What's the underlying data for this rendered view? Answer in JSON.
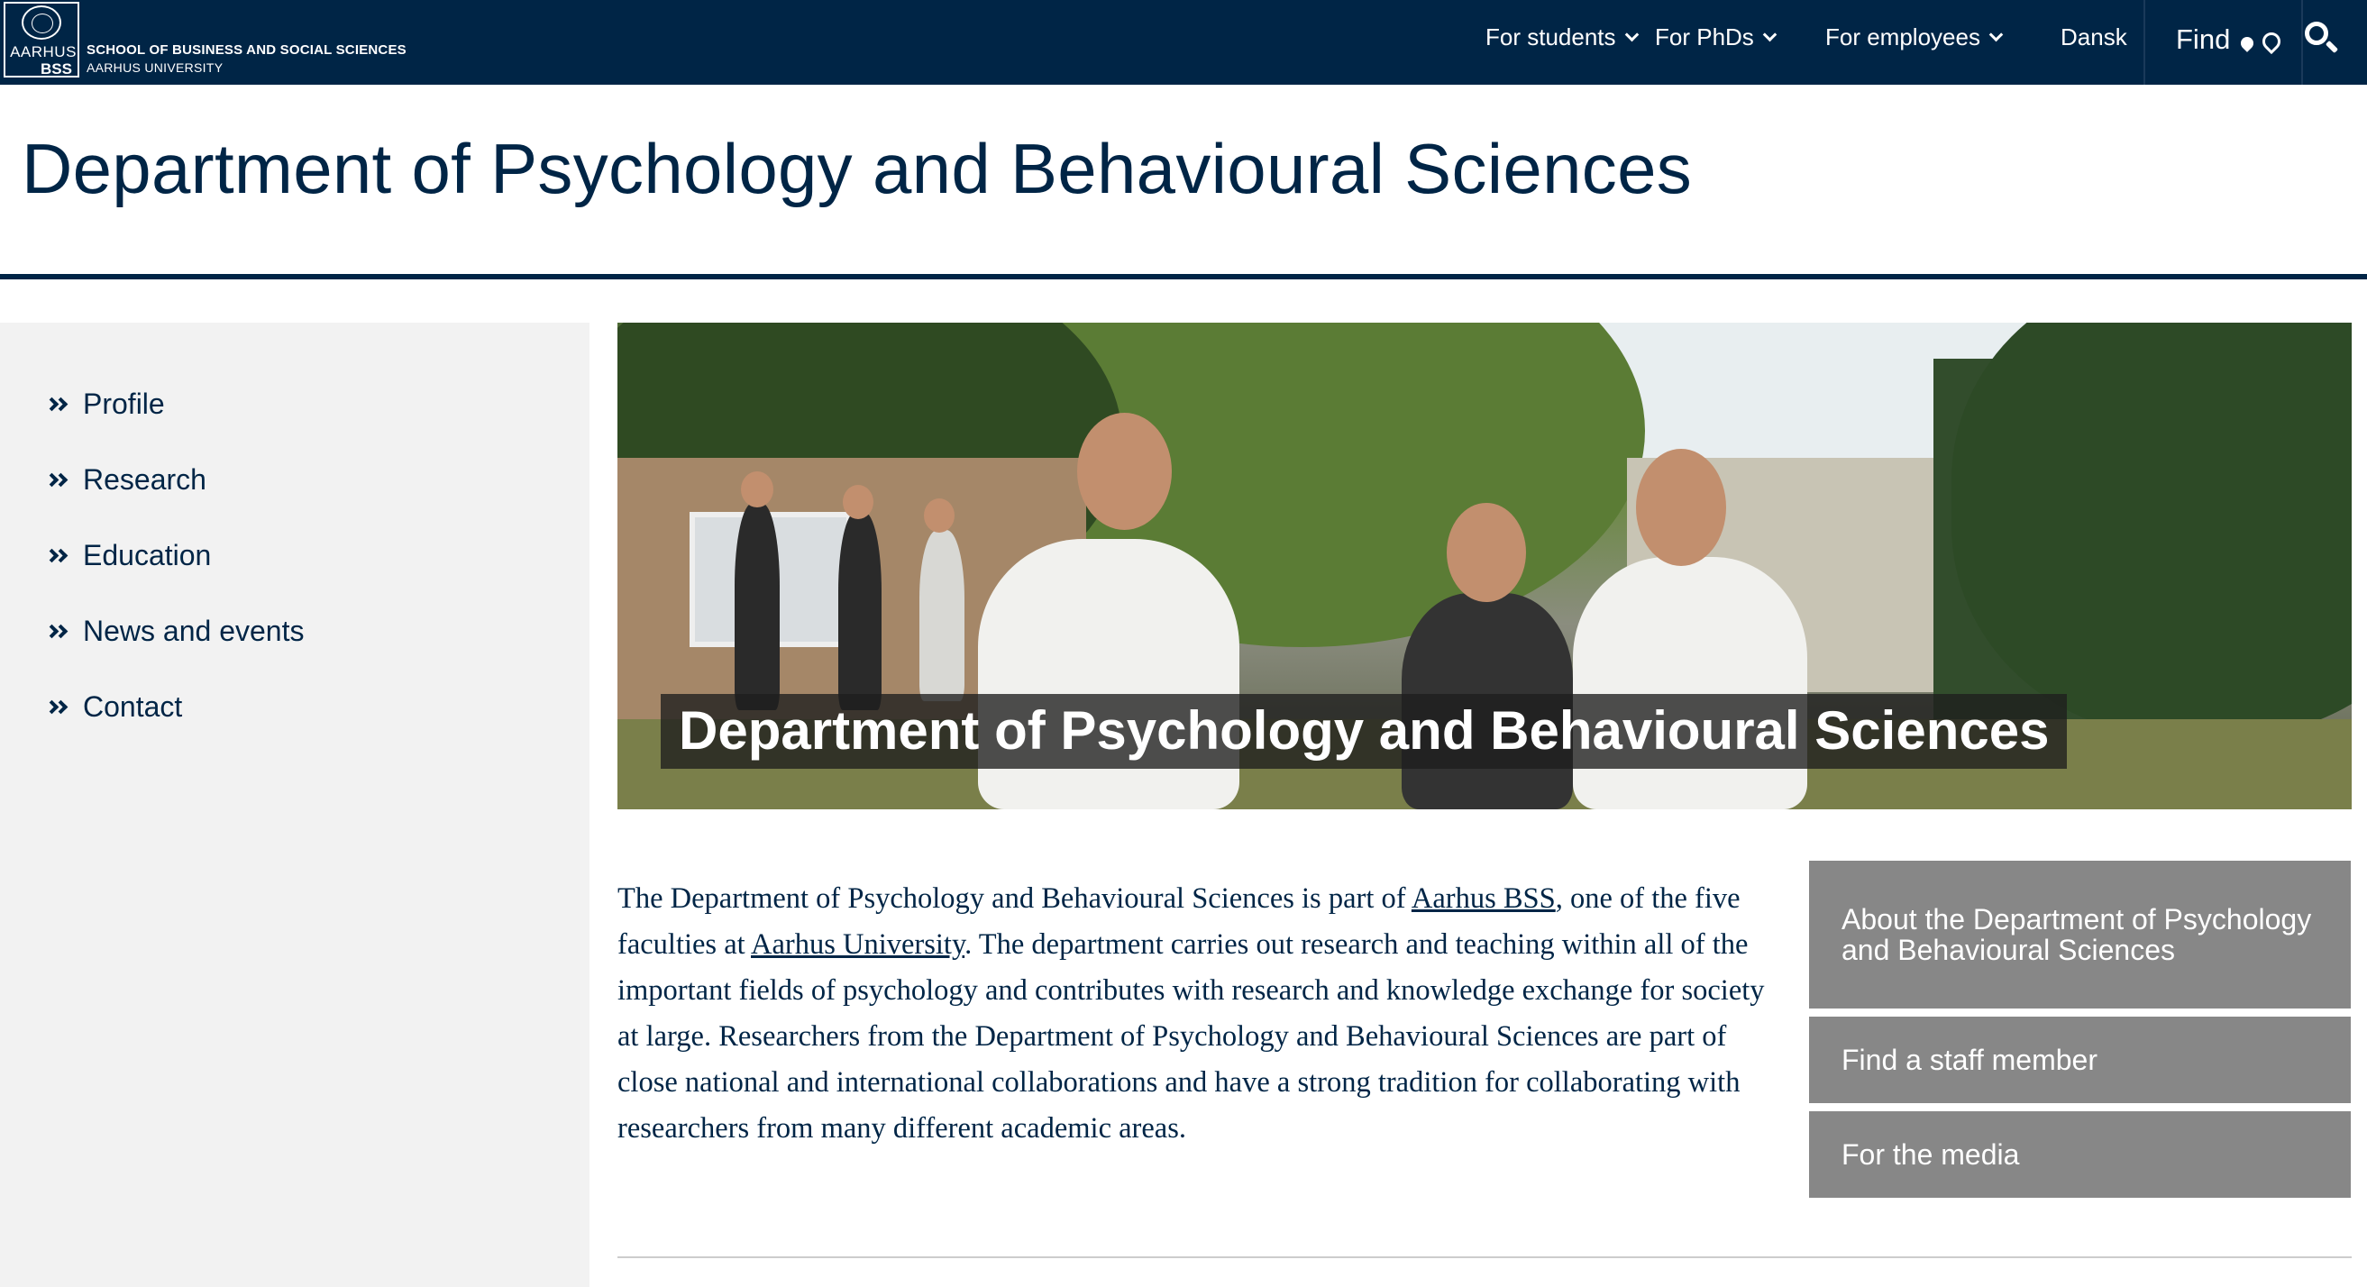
{
  "logo": {
    "line1": "AARHUS",
    "line2": "BSS",
    "school": "SCHOOL OF BUSINESS AND SOCIAL SCIENCES",
    "university": "AARHUS UNIVERSITY"
  },
  "topnav": {
    "for_students": "For students",
    "for_phds": "For PhDs",
    "for_employees": "For employees",
    "language": "Dansk",
    "find": "Find"
  },
  "page": {
    "title": "Department of Psychology and Behavioural Sciences"
  },
  "sidebar": {
    "items": [
      {
        "label": "Profile"
      },
      {
        "label": "Research"
      },
      {
        "label": "Education"
      },
      {
        "label": "News and events"
      },
      {
        "label": "Contact"
      }
    ]
  },
  "hero": {
    "caption": "Department of Psychology and Behavioural Sciences"
  },
  "intro": {
    "part1": "The Department of Psychology and Behavioural Sciences is part of ",
    "link1": "Aarhus BSS",
    "part2": ", one of the five faculties at ",
    "link2": "Aarhus University",
    "part3": ". The department carries out research and teaching within all of the important fields of psychology and contributes with research and knowledge exchange for society at large. Researchers from the Department of Psychology and Behavioural Sciences are part of close national and international collaborations and have a strong tradition for collaborating with researchers from many different academic areas."
  },
  "quicklinks": [
    {
      "label": "About the Department of Psychology and Behavioural Sciences"
    },
    {
      "label": "Find a staff member"
    },
    {
      "label": "For the media"
    }
  ],
  "colors": {
    "navy": "#002546",
    "sidebar_bg": "#f2f2f2",
    "quicklink_bg": "#878787"
  }
}
